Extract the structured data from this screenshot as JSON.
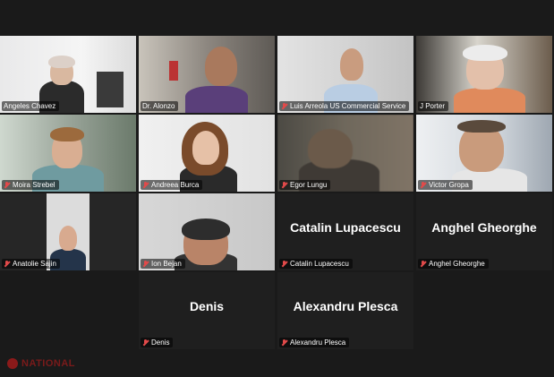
{
  "participants": [
    {
      "name": "Angeles Chavez"
    },
    {
      "name": "Dr. Alonzo"
    },
    {
      "name": "Luis Arreola US Commercial Service"
    },
    {
      "name": "J Porter"
    },
    {
      "name": "Moira Strebel"
    },
    {
      "name": "Andreea Burca"
    },
    {
      "name": "Egor Lungu"
    },
    {
      "name": "Victor Gropa"
    },
    {
      "name": "Anatolie Sajin"
    },
    {
      "name": "Ion Bejan"
    },
    {
      "name": "Catalin Lupacescu",
      "big": "Catalin Lupacescu"
    },
    {
      "name": "Anghel Gheorghe",
      "big": "Anghel Gheorghe"
    },
    {
      "name": "Denis",
      "big": "Denis"
    },
    {
      "name": "Alexandru Plesca",
      "big": "Alexandru Plesca"
    }
  ],
  "watermark": {
    "text": "NATIONAL"
  }
}
